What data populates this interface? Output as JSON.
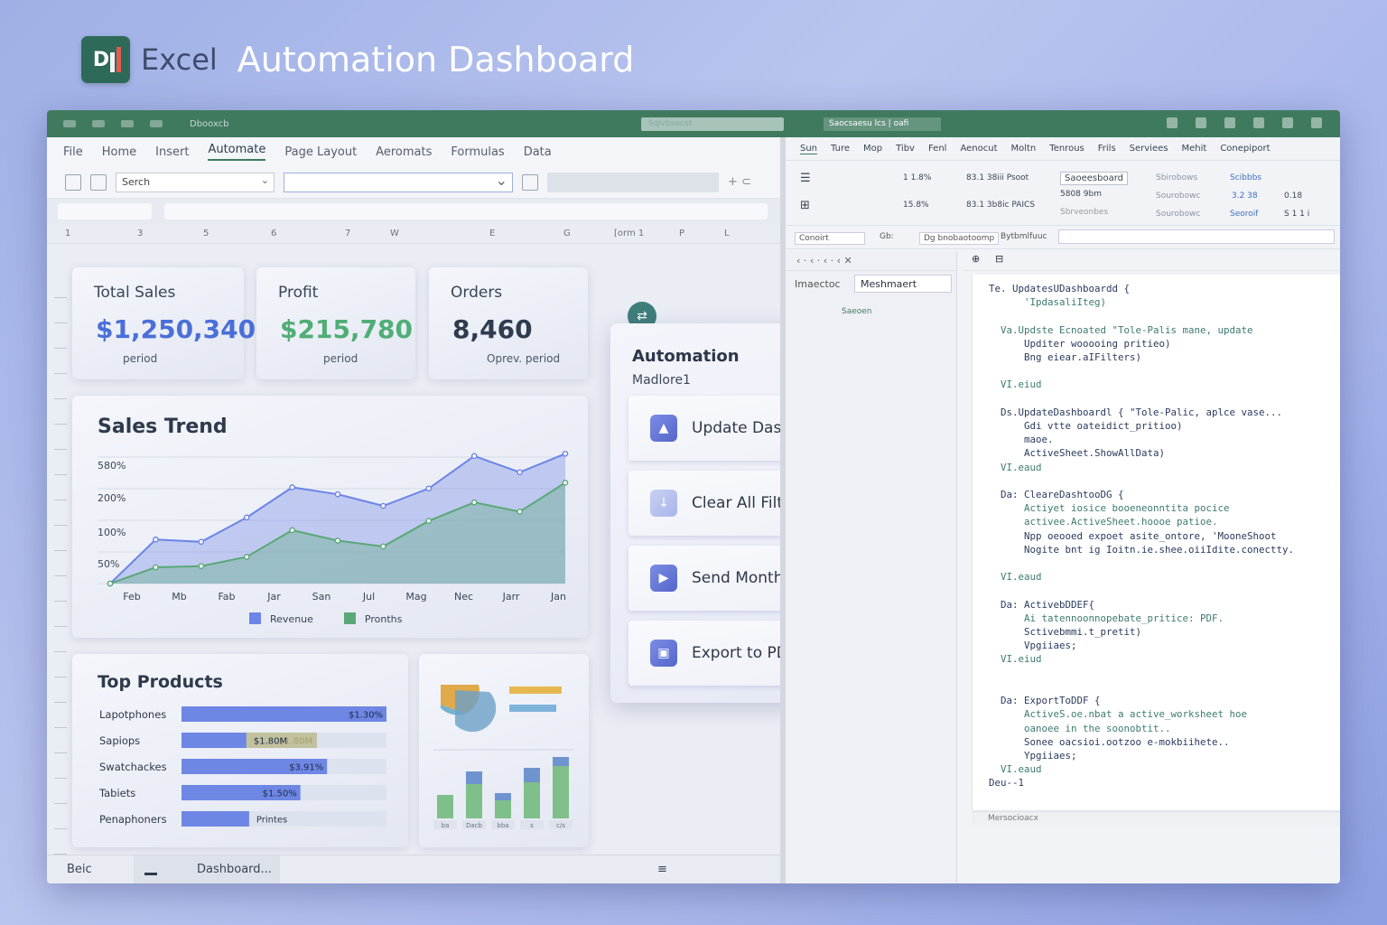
{
  "hero": {
    "app": "Excel",
    "title": "Automation Dashboard"
  },
  "titlebar": {
    "left": "Dbooxcb",
    "search": "Sqlvbsecst",
    "doc": "Saocsaesu lcs | oafi"
  },
  "menu": [
    "File",
    "Home",
    "Insert",
    "Automate",
    "Page Layout",
    "Aeromats",
    "Formulas",
    "Data"
  ],
  "toolbar": {
    "search": "Serch"
  },
  "columns": [
    "1",
    "3",
    "5",
    "6",
    "7",
    "W",
    "E",
    "G",
    "[orm 1",
    "P",
    "L"
  ],
  "kpis": [
    {
      "label": "Total Sales",
      "value": "$1,250,340",
      "sub": "period",
      "color": "#4a6fd8"
    },
    {
      "label": "Profit",
      "value": "$215,780",
      "sub": "period",
      "color": "#4fae75"
    },
    {
      "label": "Orders",
      "value": "8,460",
      "sub": "Oprev. period",
      "color": "#2f3b4e"
    }
  ],
  "sales_trend": {
    "title": "Sales Trend",
    "legend": [
      "Revenue",
      "Pronths"
    ],
    "colors": {
      "revenue": "#6c85e6",
      "profit": "#5aa877"
    }
  },
  "chart_data": [
    {
      "type": "area",
      "title": "Sales Trend",
      "categories": [
        "Feb",
        "Mb",
        "Fab",
        "Jar",
        "San",
        "Jul",
        "Mag",
        "Nec",
        "Jarr",
        "Jan"
      ],
      "y_ticks": [
        "50%",
        "100%",
        "200%",
        "580%"
      ],
      "series": [
        {
          "name": "Revenue",
          "values": [
            0,
            38,
            36,
            57,
            83,
            77,
            67,
            82,
            110,
            96,
            112
          ]
        },
        {
          "name": "Pronths",
          "values": [
            0,
            14,
            15,
            23,
            46,
            37,
            32,
            54,
            70,
            62,
            87
          ]
        }
      ]
    },
    {
      "type": "bar",
      "title": "Top Products",
      "categories": [
        "Lapotphones",
        "Sapiops",
        "Swatchackes",
        "Tabiets",
        "Penaphoners"
      ],
      "values": [
        100,
        66,
        71,
        58,
        33
      ],
      "labels": [
        "$1.30%",
        "$1.80M",
        "$3.91%",
        "$1.50%",
        "Printes"
      ]
    },
    {
      "type": "bar",
      "categories": [
        "ba",
        "Dacb",
        "bba",
        "s",
        "c/s"
      ],
      "series": [
        {
          "name": "base",
          "values": [
            26,
            38,
            20,
            40,
            58
          ]
        },
        {
          "name": "top",
          "values": [
            0,
            14,
            8,
            16,
            10
          ]
        }
      ]
    }
  ],
  "top_products": {
    "title": "Top Products"
  },
  "side_chip": "⇄",
  "automation": {
    "title": "Automation",
    "subtitle": "Madlore1",
    "help": "?",
    "buttons": [
      {
        "label": "Update Dashboard",
        "icon": "▲"
      },
      {
        "label": "Clear All Filters",
        "icon": "↓"
      },
      {
        "label": "Send Monthly Report",
        "icon": "▶"
      },
      {
        "label": "Export to PDF",
        "icon": "▣"
      }
    ]
  },
  "statusbar": {
    "left": "Beic",
    "tab": "Dashboard...",
    "menu": "≡"
  },
  "right_menu": [
    "Sun",
    "Ture",
    "Mop",
    "Tibv",
    "Fenl",
    "Aenocut",
    "Moltn",
    "Tenrous",
    "Frils",
    "Serviees",
    "Mehit",
    "Conepiport"
  ],
  "right_ribbon": {
    "pct1": "1 1.8%",
    "pct2": "15.8%",
    "r1": "83.1 38iii Psoot",
    "r2": "83.1 3b8ic PAICS",
    "sb": "Saoeesboard",
    "sb2": "5808 9bm",
    "sb3": "Sbrveonbes",
    "s1": "Sbirobows",
    "s2": "Sourobowc",
    "s3": "Sourobowc",
    "sv": "Scibbbs",
    "v1": "3.2 38",
    "v2": "Seoroif",
    "n1": "0.18",
    "n2": "S 1 1 i"
  },
  "right_sel": {
    "a": "Conoirt",
    "b": "Gb:",
    "c": "Dg bnobaotoomp",
    "d": "Bytbmlfuuc"
  },
  "project": {
    "label": "Imaectoc",
    "field": "Meshmaert",
    "sub": "Saeoen"
  },
  "code_footer": "Mersocioacx",
  "code_lines": [
    {
      "t": "Te. UpdatesUDashboardd {",
      "c": "k"
    },
    {
      "t": "      'IpdasaliIteg)",
      "c": "c"
    },
    {
      "t": "",
      "c": "k"
    },
    {
      "t": "  Va.Updste Ecnoated \"Tole-Palis mane, update",
      "c": "c"
    },
    {
      "t": "      Upditer wooooing pritieo)",
      "c": "k"
    },
    {
      "t": "      Bng eiear.aIFilters)",
      "c": "k"
    },
    {
      "t": "",
      "c": "k"
    },
    {
      "t": "  VI.eiud",
      "c": "c"
    },
    {
      "t": "",
      "c": "k"
    },
    {
      "t": "  Ds.UpdateDashboardl { \"Tole-Palic, aplce vase...",
      "c": "k"
    },
    {
      "t": "      Gdi vtte oateidict_pritioo)",
      "c": "k"
    },
    {
      "t": "      maoe.",
      "c": "k"
    },
    {
      "t": "      ActiveSheet.ShowAllData)",
      "c": "k"
    },
    {
      "t": "  VI.eaud",
      "c": "c"
    },
    {
      "t": "",
      "c": "k"
    },
    {
      "t": "  Da: CleareDashtooDG {",
      "c": "k"
    },
    {
      "t": "      Actiyet iosice booeneonntita pocice",
      "c": "c"
    },
    {
      "t": "      activee.ActiveSheet.hoooe patioe.",
      "c": "c"
    },
    {
      "t": "      Npp oeooed expoet asite_ontore, 'MooneShoot",
      "c": "k"
    },
    {
      "t": "      Nogite bnt ig Ioitn.ie.shee.oiiIdite.conectty.",
      "c": "k"
    },
    {
      "t": "",
      "c": "k"
    },
    {
      "t": "  VI.eaud",
      "c": "c"
    },
    {
      "t": "",
      "c": "k"
    },
    {
      "t": "  Da: ActivebDDEF{",
      "c": "k"
    },
    {
      "t": "      Ai tatennoonnopebate_pritice: PDF.",
      "c": "c"
    },
    {
      "t": "      Sctivebmmi.t_pretit)",
      "c": "k"
    },
    {
      "t": "      Vpgiiaes;",
      "c": "k"
    },
    {
      "t": "  VI.eiud",
      "c": "c"
    },
    {
      "t": "",
      "c": "k"
    },
    {
      "t": "",
      "c": "k"
    },
    {
      "t": "  Da: ExportToDDF {",
      "c": "k"
    },
    {
      "t": "      ActiveS.oe.nbat a active_worksheet hoe",
      "c": "c"
    },
    {
      "t": "      oanoee in the soonobtit..",
      "c": "c"
    },
    {
      "t": "      Sonee oacsioi.ootzoo e-mokbiihete..",
      "c": "k"
    },
    {
      "t": "      Ypgiiaes;",
      "c": "k"
    },
    {
      "t": "  VI.eaud",
      "c": "c"
    },
    {
      "t": "Deu--1",
      "c": "k"
    }
  ]
}
